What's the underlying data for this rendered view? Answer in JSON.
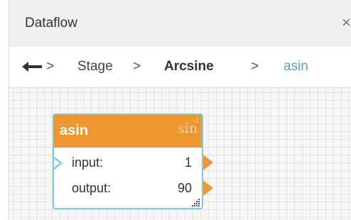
{
  "panel": {
    "title": "Dataflow",
    "close_label": "×"
  },
  "breadcrumb": {
    "back_icon": "back-arrow-icon",
    "separator": ">",
    "items": [
      "Stage",
      "Arcsine",
      "asin"
    ]
  },
  "node": {
    "title": "asin",
    "function_symbol": "sin",
    "function_superscript": "-1",
    "input_label": "input:",
    "input_value": "1",
    "output_label": "output:",
    "output_value": "90"
  },
  "colors": {
    "header": "#f0962e",
    "node_border": "#7ccbe4",
    "link": "#4aa8c8",
    "port": "#f0962e",
    "input_port": "#7ccbe4"
  }
}
